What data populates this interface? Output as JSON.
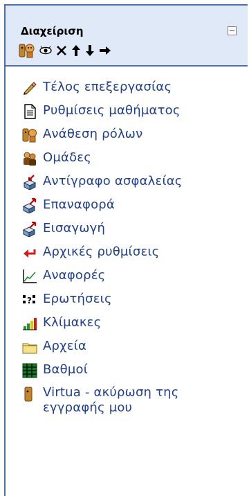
{
  "block": {
    "title": "Διαχείριση",
    "controls": [
      "assign-roles-icon",
      "eye-icon",
      "delete-icon",
      "move-up-icon",
      "move-down-icon",
      "move-right-icon"
    ],
    "items": [
      {
        "label": "Τέλος επεξεργασίας",
        "icon": "edit-pencil-icon"
      },
      {
        "label": "Ρυθμίσεις μαθήματος",
        "icon": "settings-doc-icon"
      },
      {
        "label": "Ανάθεση ρόλων",
        "icon": "roles-icon"
      },
      {
        "label": "Ομάδες",
        "icon": "groups-icon"
      },
      {
        "label": "Αντίγραφο ασφαλείας",
        "icon": "backup-icon"
      },
      {
        "label": "Επαναφορά",
        "icon": "restore-icon"
      },
      {
        "label": "Εισαγωγή",
        "icon": "import-icon"
      },
      {
        "label": "Αρχικές ρυθμίσεις",
        "icon": "reset-icon"
      },
      {
        "label": "Αναφορές",
        "icon": "reports-icon"
      },
      {
        "label": "Ερωτήσεις",
        "icon": "questions-icon"
      },
      {
        "label": "Κλίμακες",
        "icon": "scales-icon"
      },
      {
        "label": "Αρχεία",
        "icon": "folder-icon"
      },
      {
        "label": "Βαθμοί",
        "icon": "grades-icon"
      },
      {
        "label": "Virtua - ακύρωση της εγγραφής μου",
        "icon": "unenrol-icon"
      }
    ]
  }
}
